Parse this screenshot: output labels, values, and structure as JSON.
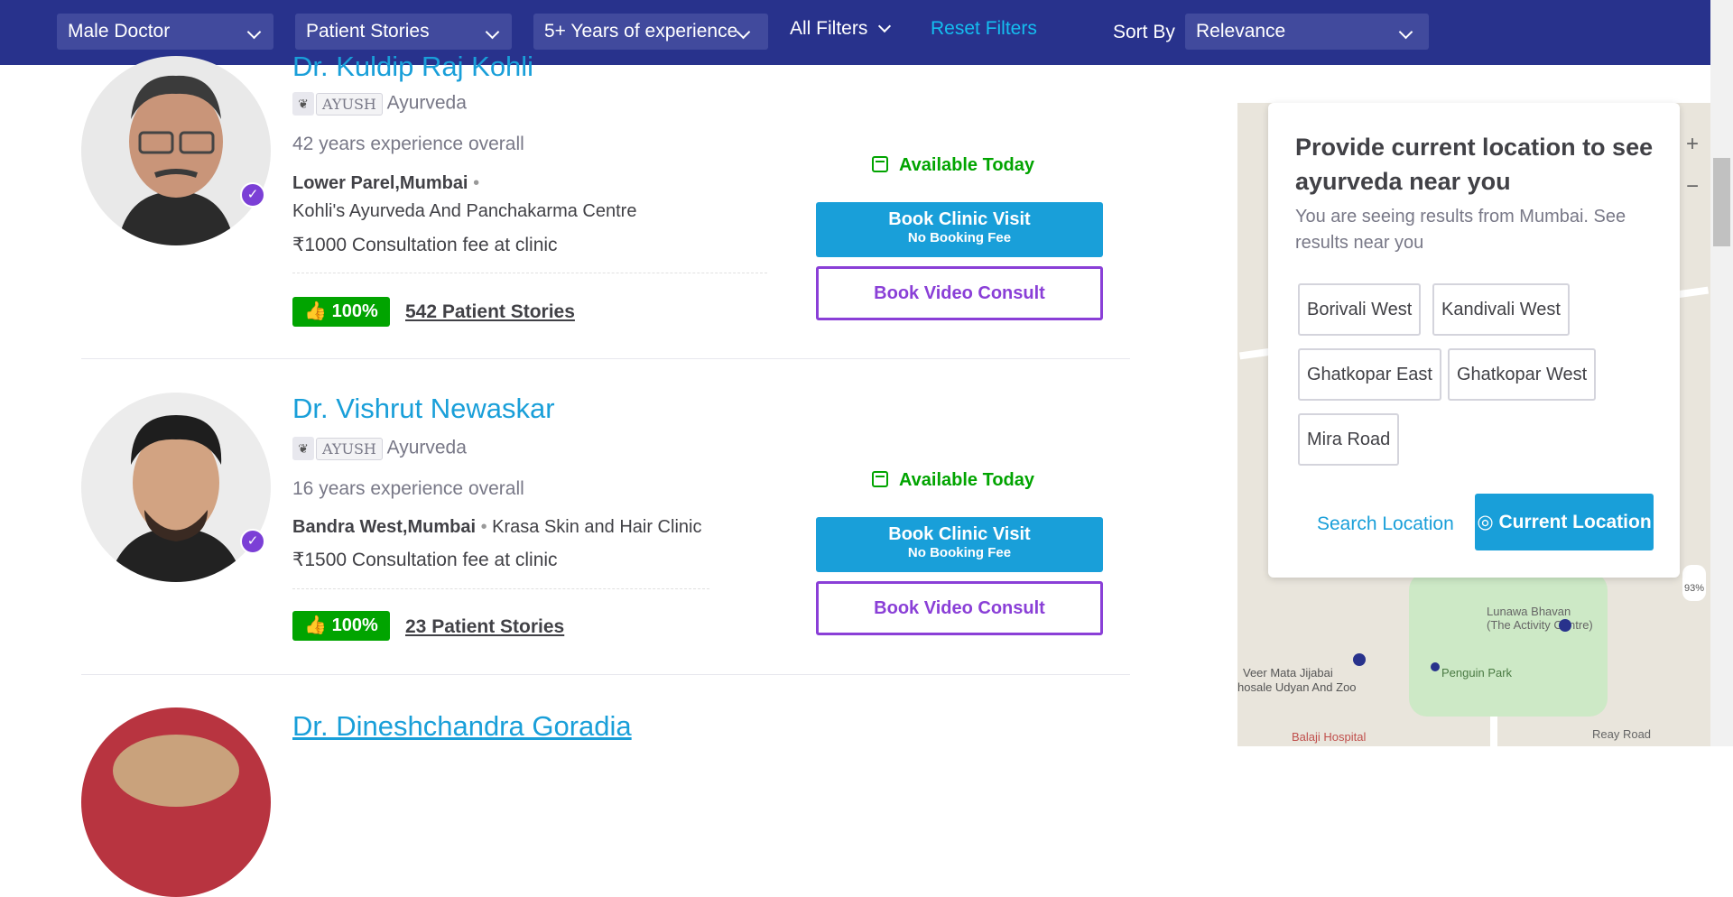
{
  "filters": {
    "gender": "Male Doctor",
    "stories": "Patient Stories",
    "experience": "5+ Years of experience",
    "all_filters": "All Filters",
    "reset": "Reset Filters",
    "sort_label": "Sort By",
    "sort_value": "Relevance"
  },
  "doctors": [
    {
      "name": "Dr. Kuldip Raj Kohli",
      "badge": "AYUSH",
      "specialty": "Ayurveda",
      "experience": "42 years experience overall",
      "locality": "Lower Parel,Mumbai",
      "clinic": "Kohli's Ayurveda And Panchakarma Centre",
      "fee": "₹1000 Consultation fee at clinic",
      "rating": "100%",
      "stories": "542 Patient Stories",
      "availability": "Available Today",
      "book_clinic": "Book Clinic Visit",
      "no_fee": "No Booking Fee",
      "book_video": "Book Video Consult"
    },
    {
      "name": "Dr. Vishrut Newaskar",
      "badge": "AYUSH",
      "specialty": "Ayurveda",
      "experience": "16 years experience overall",
      "locality": "Bandra West,Mumbai",
      "clinic": "Krasa Skin and Hair Clinic",
      "fee": "₹1500 Consultation fee at clinic",
      "rating": "100%",
      "stories": "23 Patient Stories",
      "availability": "Available Today",
      "book_clinic": "Book Clinic Visit",
      "no_fee": "No Booking Fee",
      "book_video": "Book Video Consult"
    },
    {
      "name": "Dr. Dineshchandra Goradia"
    }
  ],
  "location_popup": {
    "title": "Provide current location to see ayurveda near you",
    "subtitle": "You are seeing results from Mumbai. See results near you",
    "chips": [
      "Borivali West",
      "Kandivali West",
      "Ghatkopar East",
      "Ghatkopar West",
      "Mira Road"
    ],
    "search": "Search Location",
    "current": "Current Location"
  },
  "map": {
    "labels": [
      "Lunawa Bhavan",
      "(The Activity Centre)",
      "Veer Mata Jijabai",
      "hosale Udyan And Zoo",
      "Penguin Park",
      "Balaji Hospital",
      "Reay Road",
      "93%"
    ],
    "zoom_in": "+",
    "zoom_out": "−"
  },
  "colors": {
    "header": "#28328c",
    "accent": "#199fd9",
    "green": "#01a400",
    "purple": "#8a3fd7"
  }
}
